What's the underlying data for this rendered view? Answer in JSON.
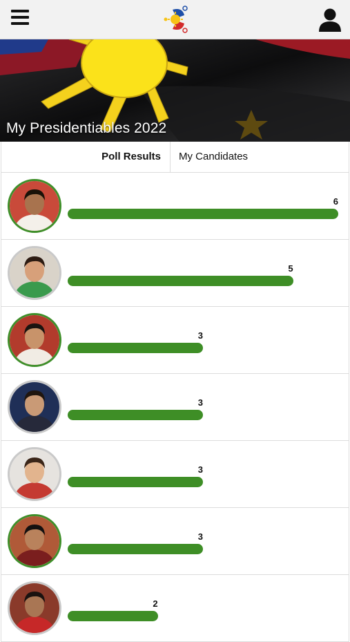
{
  "app": {
    "banner_title": "My Presidentiables 2022"
  },
  "tabs": [
    {
      "label": "Poll Results",
      "active": true
    },
    {
      "label": "My Candidates",
      "active": false
    }
  ],
  "colors": {
    "bar": "#3e8e26",
    "highlight_ring": "#3f8f2a",
    "default_ring": "#c9c9c9",
    "appbar": "#f2f2f2"
  },
  "icons": {
    "menu": "hamburger-menu-icon",
    "logo": "philippine-flag-logo-icon",
    "account": "user-account-icon"
  },
  "chart_data": {
    "type": "bar",
    "orientation": "horizontal",
    "values": [
      6,
      5,
      3,
      3,
      3,
      3,
      2
    ],
    "highlighted": [
      true,
      false,
      true,
      false,
      false,
      true,
      false
    ],
    "xlim": [
      0,
      6
    ]
  }
}
